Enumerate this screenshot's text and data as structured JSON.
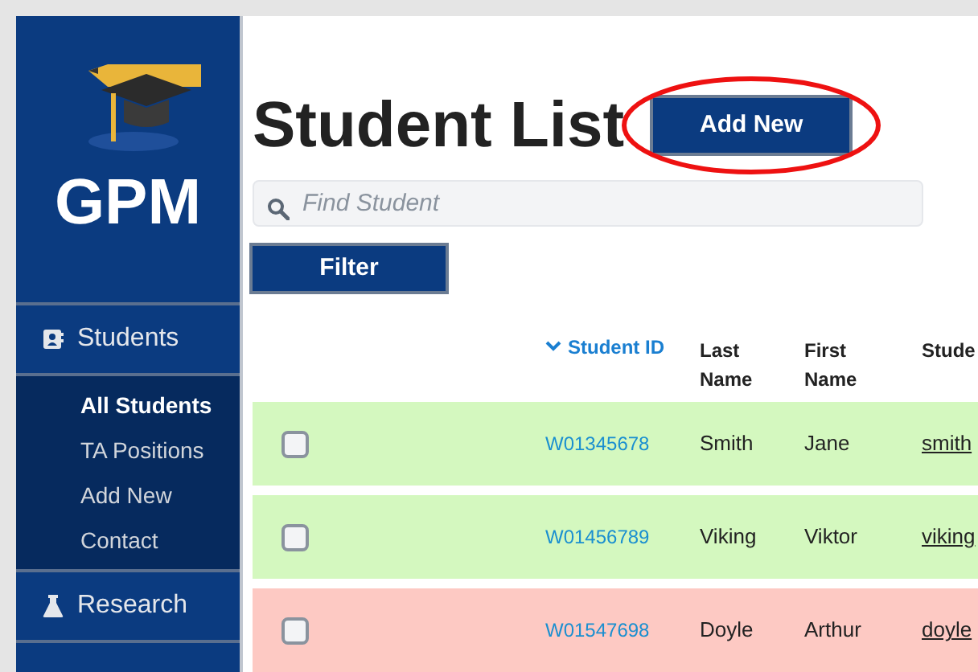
{
  "sidebar": {
    "logo": "GPM",
    "sections": [
      {
        "label": "Students",
        "children": [
          {
            "label": "All Students",
            "selected": true
          },
          {
            "label": "TA Positions",
            "selected": false
          },
          {
            "label": "Add New",
            "selected": false
          },
          {
            "label": "Contact",
            "selected": false
          }
        ]
      },
      {
        "label": "Research"
      }
    ]
  },
  "page": {
    "title": "Student List",
    "add_button": "Add New"
  },
  "search": {
    "placeholder": "Find Student"
  },
  "filter_button": "Filter",
  "table": {
    "columns": [
      {
        "label": "Student ID",
        "sorted": true
      },
      {
        "label": "Last Name",
        "sorted": false
      },
      {
        "label": "First Name",
        "sorted": false
      },
      {
        "label": "Stude",
        "sorted": false
      }
    ],
    "rows": [
      {
        "checked": false,
        "color": "#d4f8bf",
        "id": "W01345678",
        "last": "Smith",
        "first": "Jane",
        "email": "smith"
      },
      {
        "checked": false,
        "color": "#d4f8bf",
        "id": "W01456789",
        "last": "Viking",
        "first": "Viktor",
        "email": "viking"
      },
      {
        "checked": false,
        "color": "#fdc9c3",
        "id": "W01547698",
        "last": "Doyle",
        "first": "Arthur",
        "email": "doyle"
      }
    ]
  }
}
